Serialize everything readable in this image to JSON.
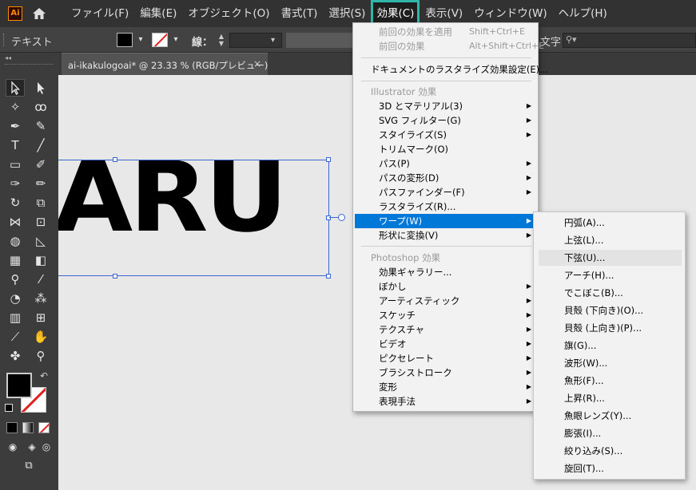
{
  "app": {
    "logo_text": "Ai"
  },
  "menubar": {
    "items": [
      {
        "label": "ファイル(F)"
      },
      {
        "label": "編集(E)"
      },
      {
        "label": "オブジェクト(O)"
      },
      {
        "label": "書式(T)"
      },
      {
        "label": "選択(S)"
      },
      {
        "label": "効果(C)",
        "active": true
      },
      {
        "label": "表示(V)"
      },
      {
        "label": "ウィンドウ(W)"
      },
      {
        "label": "ヘルプ(H)"
      }
    ]
  },
  "controlbar": {
    "label": "テキスト",
    "stroke_label": "線：",
    "font_label": "文字：",
    "font_search_placeholder": "",
    "colors": {
      "fill": "#000000",
      "stroke": "#ffffff",
      "none_slash": "#e02020"
    }
  },
  "document": {
    "tab_title": "ai-ikakulogoai* @ 23.33 % (RGB/プレビュー)",
    "close_glyph": "×",
    "artwork_text": "ARU",
    "selection_color": "#3b66d1"
  },
  "effect_menu": {
    "apply_last": {
      "label": "前回の効果を適用",
      "shortcut": "Shift+Ctrl+E"
    },
    "last_effect": {
      "label": "前回の効果",
      "shortcut": "Alt+Shift+Ctrl+E"
    },
    "raster_settings": "ドキュメントのラスタライズ効果設定(E)...",
    "illustrator_header": "Illustrator 効果",
    "illustrator_items": [
      {
        "label": "3D とマテリアル(3)",
        "submenu": true
      },
      {
        "label": "SVG フィルター(G)",
        "submenu": true
      },
      {
        "label": "スタイライズ(S)",
        "submenu": true
      },
      {
        "label": "トリムマーク(O)",
        "submenu": false
      },
      {
        "label": "パス(P)",
        "submenu": true
      },
      {
        "label": "パスの変形(D)",
        "submenu": true
      },
      {
        "label": "パスファインダー(F)",
        "submenu": true
      },
      {
        "label": "ラスタライズ(R)...",
        "submenu": false
      },
      {
        "label": "ワープ(W)",
        "submenu": true,
        "highlighted": true
      },
      {
        "label": "形状に変換(V)",
        "submenu": true
      }
    ],
    "photoshop_header": "Photoshop 効果",
    "photoshop_items": [
      {
        "label": "効果ギャラリー...",
        "submenu": false
      },
      {
        "label": "ぼかし",
        "submenu": true
      },
      {
        "label": "アーティスティック",
        "submenu": true
      },
      {
        "label": "スケッチ",
        "submenu": true
      },
      {
        "label": "テクスチャ",
        "submenu": true
      },
      {
        "label": "ビデオ",
        "submenu": true
      },
      {
        "label": "ピクセレート",
        "submenu": true
      },
      {
        "label": "ブラシストローク",
        "submenu": true
      },
      {
        "label": "変形",
        "submenu": true
      },
      {
        "label": "表現手法",
        "submenu": true
      }
    ],
    "highlight_color": "#0078d7",
    "accent_outline": "#2fb6a8"
  },
  "warp_submenu": {
    "items": [
      {
        "label": "円弧(A)..."
      },
      {
        "label": "上弦(L)..."
      },
      {
        "label": "下弦(U)...",
        "hover": true
      },
      {
        "label": "アーチ(H)..."
      },
      {
        "label": "でこぼこ(B)..."
      },
      {
        "label": "貝殻 (下向き)(O)..."
      },
      {
        "label": "貝殻 (上向き)(P)..."
      },
      {
        "label": "旗(G)..."
      },
      {
        "label": "波形(W)..."
      },
      {
        "label": "魚形(F)..."
      },
      {
        "label": "上昇(R)..."
      },
      {
        "label": "魚眼レンズ(Y)..."
      },
      {
        "label": "膨張(I)..."
      },
      {
        "label": "絞り込み(S)..."
      },
      {
        "label": "旋回(T)..."
      }
    ]
  }
}
